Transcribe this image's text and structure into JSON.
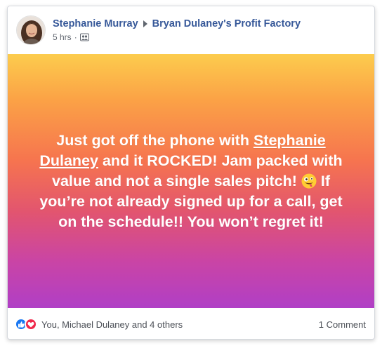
{
  "post": {
    "author": "Stephanie Murray",
    "group": "Bryan Dulaney's Profit Factory",
    "time": "5 hrs",
    "separator": "·",
    "text_part1": "Just got off the phone with ",
    "mention": "Stephanie Dulaney",
    "text_part2": " and it ROCKED! Jam packed with value and not a single sales pitch! ",
    "text_part3": " If you’re not already signed up for a call, get on the schedule!! You won’t regret it!",
    "emoji": "zany-face-emoji",
    "reactions_text": "You, Michael Dulaney and 4 others",
    "comments_text": "1 Comment"
  },
  "colors": {
    "link_blue": "#365899",
    "gradient_top": "#fccc4d",
    "gradient_bottom": "#b03fc6",
    "like_blue": "#1877f2",
    "love_red": "#f0284a"
  },
  "icons": {
    "like": "like-icon",
    "love": "love-icon",
    "group": "group-icon"
  }
}
